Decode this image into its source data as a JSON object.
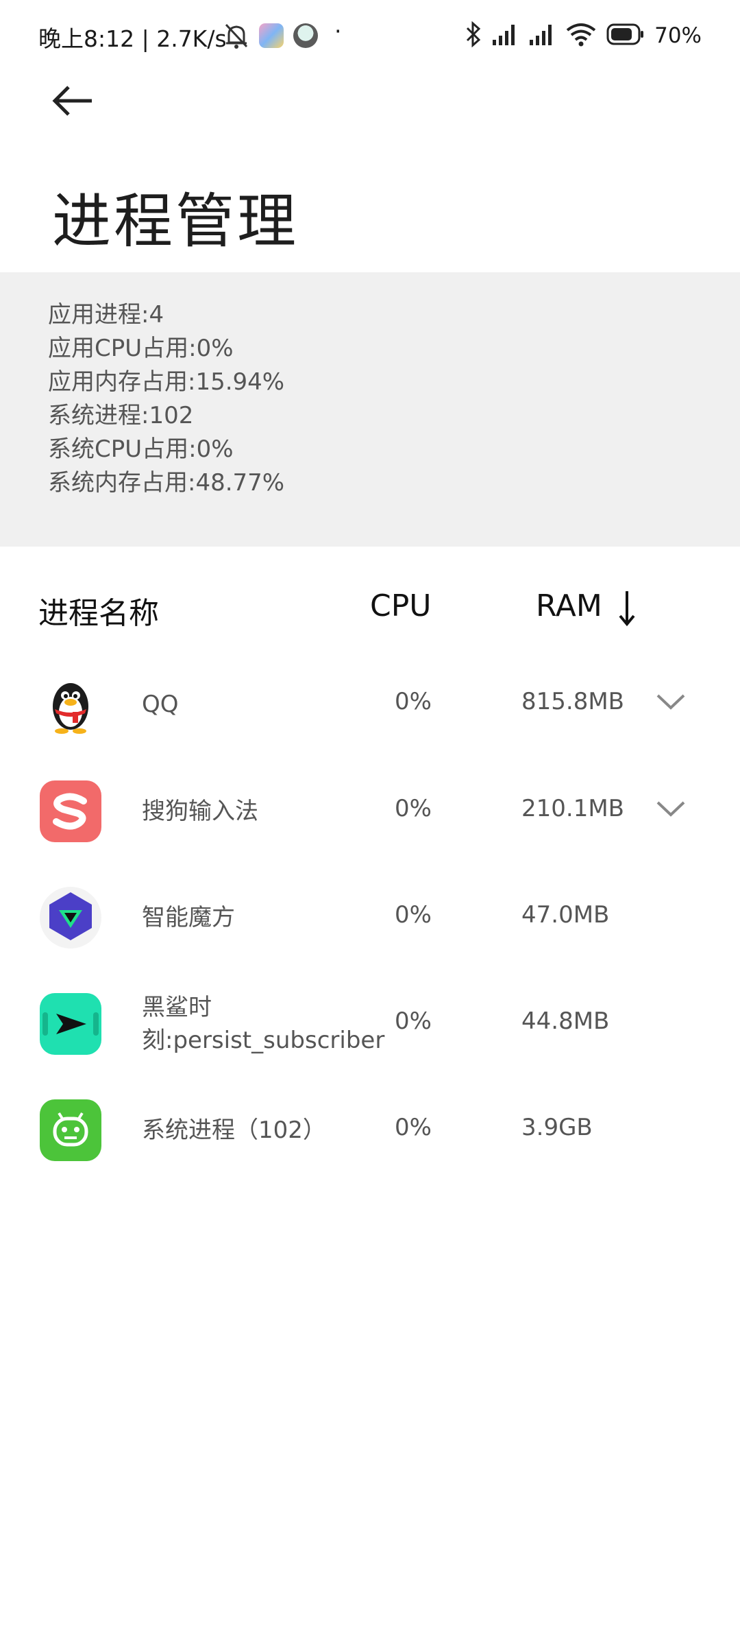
{
  "status_bar": {
    "left_text": "晚上8:12 | 2.7K/s",
    "dot": "·",
    "battery_text": "70%",
    "icons": [
      "mute-bell-icon",
      "app-icon",
      "avatar-icon",
      "bluetooth-icon",
      "signal-icon",
      "signal-icon",
      "wifi-icon",
      "battery-icon"
    ]
  },
  "header": {
    "back_icon": "arrow-left-icon",
    "title": "进程管理"
  },
  "summary": {
    "app_processes": "应用进程:4",
    "app_cpu": "应用CPU占用:0%",
    "app_mem": "应用内存占用:15.94%",
    "sys_processes": "系统进程:102",
    "sys_cpu": "系统CPU占用:0%",
    "sys_mem": "系统内存占用:48.77%"
  },
  "table": {
    "col_name": "进程名称",
    "col_cpu": "CPU",
    "col_ram": "RAM",
    "sort_icon": "arrow-down-icon",
    "rows": [
      {
        "name": "QQ",
        "cpu": "0%",
        "ram": "815.8MB",
        "icon": "qq-penguin-icon",
        "expandable": true
      },
      {
        "name": "搜狗输入法",
        "cpu": "0%",
        "ram": "210.1MB",
        "icon": "sogou-icon",
        "expandable": true
      },
      {
        "name": "智能魔方",
        "cpu": "0%",
        "ram": "47.0MB",
        "icon": "magic-cube-icon",
        "expandable": false
      },
      {
        "name_line1": "黑鲨时",
        "name_line2": "刻:persist_subscriber",
        "cpu": "0%",
        "ram": "44.8MB",
        "icon": "black-shark-icon",
        "expandable": false
      },
      {
        "name": "系统进程（102）",
        "cpu": "0%",
        "ram": "3.9GB",
        "icon": "android-icon",
        "expandable": false
      }
    ]
  },
  "colors": {
    "summary_bg": "#f0f0f0",
    "sogou_red": "#f26a6a",
    "cube_purple": "#4b3fc7",
    "shark_teal": "#1fe0b0",
    "android_green": "#4cc43a"
  }
}
